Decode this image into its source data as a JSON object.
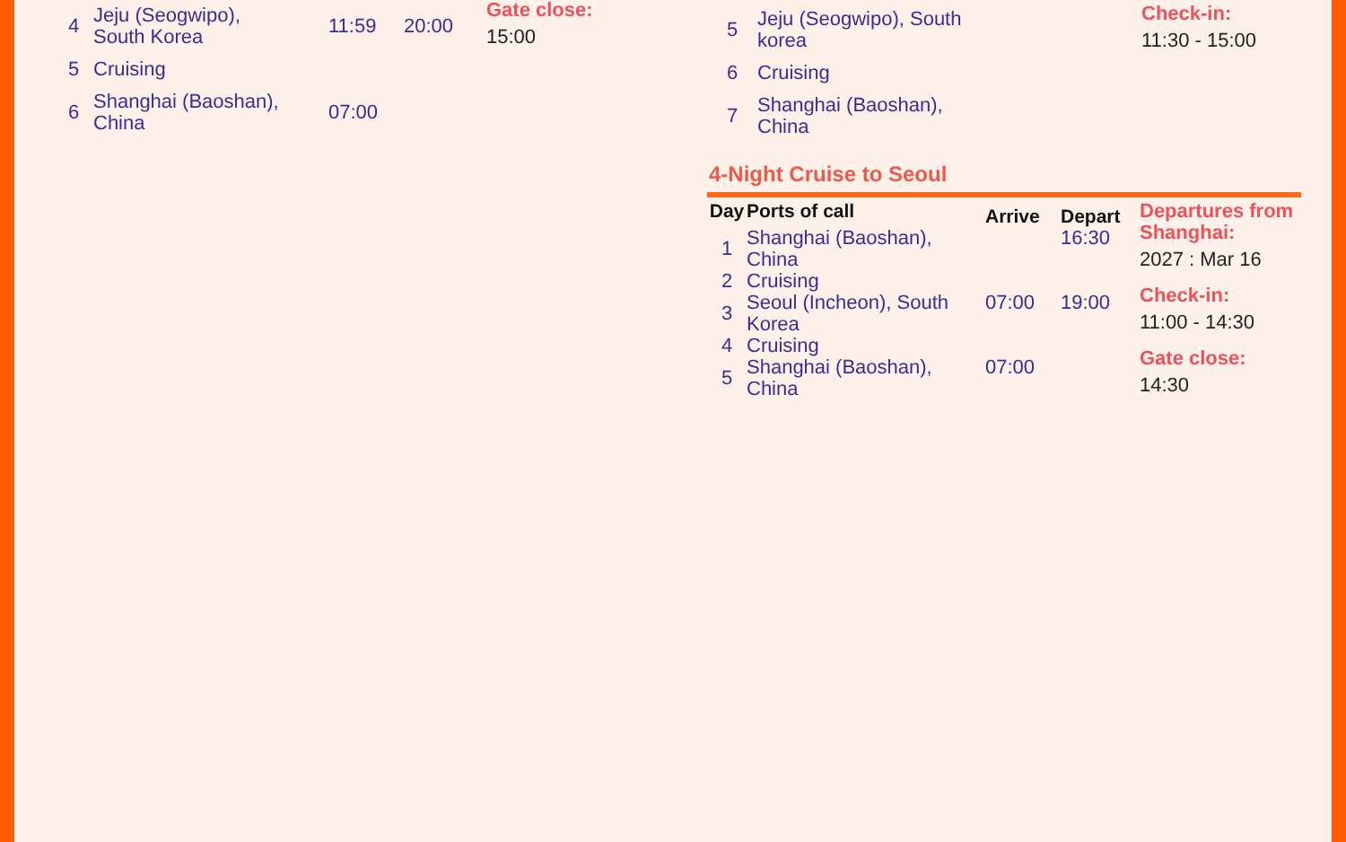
{
  "left": {
    "rows": [
      {
        "day": "4",
        "port": "Jeju (Seogwipo), South Korea",
        "arrive": "11:59",
        "depart": "20:00"
      },
      {
        "day": "5",
        "port": "Cruising"
      },
      {
        "day": "6",
        "port": "Shanghai (Baoshan), China",
        "arrive": "07:00"
      }
    ],
    "info": [
      {
        "label": "Gate close:",
        "value": "15:00"
      }
    ]
  },
  "right": [
    {
      "rows": [
        {
          "day": "5",
          "port": "Jeju (Seogwipo), South korea"
        },
        {
          "day": "6",
          "port": "Cruising"
        },
        {
          "day": "7",
          "port": "Shanghai (Baoshan), China"
        }
      ],
      "info": [
        {
          "label": "Check-in:",
          "value": "11:30 - 15:00"
        }
      ]
    },
    {
      "title": "4-Night Cruise to Seoul",
      "columns": [
        "Day",
        "Ports of call",
        "Arrive",
        "Depart"
      ],
      "rows": [
        {
          "day": "1",
          "port": "Shanghai (Baoshan), China",
          "depart": "16:30"
        },
        {
          "day": "2",
          "port": "Cruising"
        },
        {
          "day": "3",
          "port": "Seoul (Incheon), South Korea",
          "arrive": "07:00",
          "depart": "19:00"
        },
        {
          "day": "4",
          "port": "Cruising"
        },
        {
          "day": "5",
          "port": "Shanghai (Baoshan), China",
          "arrive": "07:00"
        }
      ],
      "info": [
        {
          "label": "Departures from Shanghai:",
          "value": "2027 : Mar 16"
        },
        {
          "label": "Check-in:",
          "value": "11:00 - 14:30"
        },
        {
          "label": "Gate close:",
          "value": "14:30"
        }
      ]
    }
  ]
}
